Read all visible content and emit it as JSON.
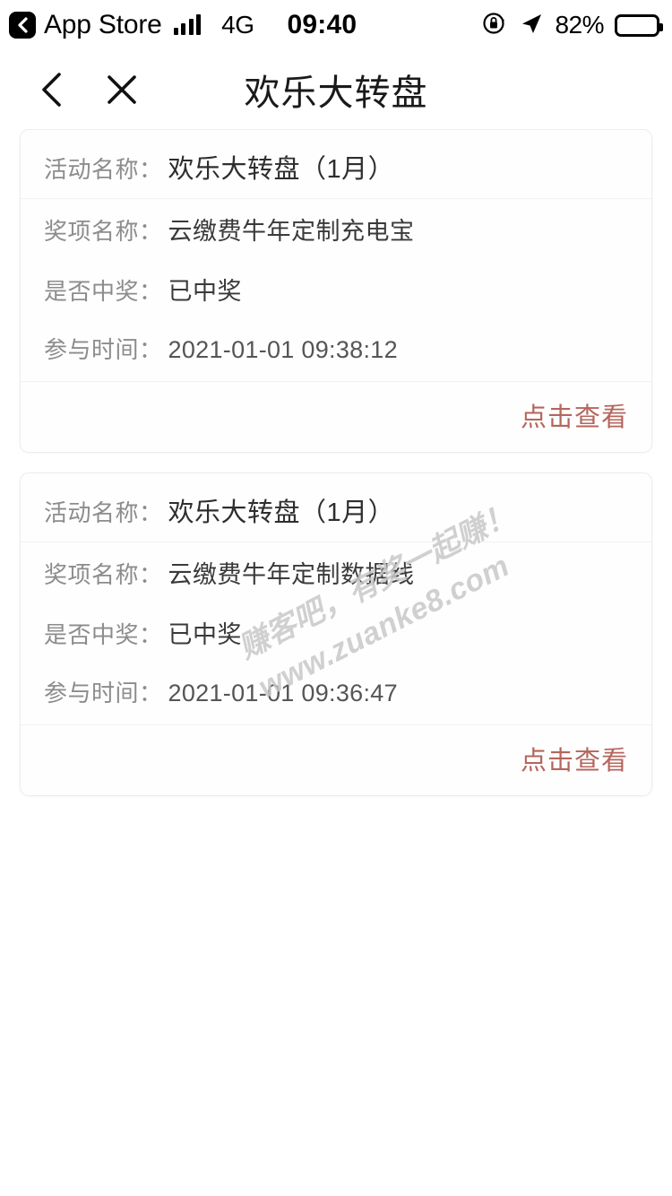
{
  "status_bar": {
    "back_app_label": "App Store",
    "back_icon": "chevron-left-icon",
    "signal_icon": "cellular-signal-icon",
    "network": "4G",
    "time": "09:40",
    "rotation_lock_icon": "rotation-lock-icon",
    "location_icon": "location-arrow-icon",
    "battery_percent": "82%",
    "battery_icon": "battery-icon"
  },
  "nav": {
    "back_icon": "chevron-left-icon",
    "close_icon": "close-icon",
    "title": "欢乐大转盘"
  },
  "labels": {
    "activity": "活动名称：",
    "prize": "奖项名称：",
    "is_winner": "是否中奖：",
    "join_time": "参与时间：",
    "view": "点击查看"
  },
  "cards": [
    {
      "activity": "欢乐大转盘（1月）",
      "prize": "云缴费牛年定制充电宝",
      "is_winner": "已中奖",
      "join_time": "2021-01-01 09:38:12",
      "action": "点击查看"
    },
    {
      "activity": "欢乐大转盘（1月）",
      "prize": "云缴费牛年定制数据线",
      "is_winner": "已中奖",
      "join_time": "2021-01-01 09:36:47",
      "action": "点击查看"
    }
  ],
  "watermark": {
    "line1": "赚客吧，有奖一起赚！",
    "line2": "www.zuanke8.com"
  },
  "colors": {
    "link": "#b5655c",
    "label": "#8c8c8c",
    "value": "#3a3a3a",
    "background": "#ffffff"
  }
}
